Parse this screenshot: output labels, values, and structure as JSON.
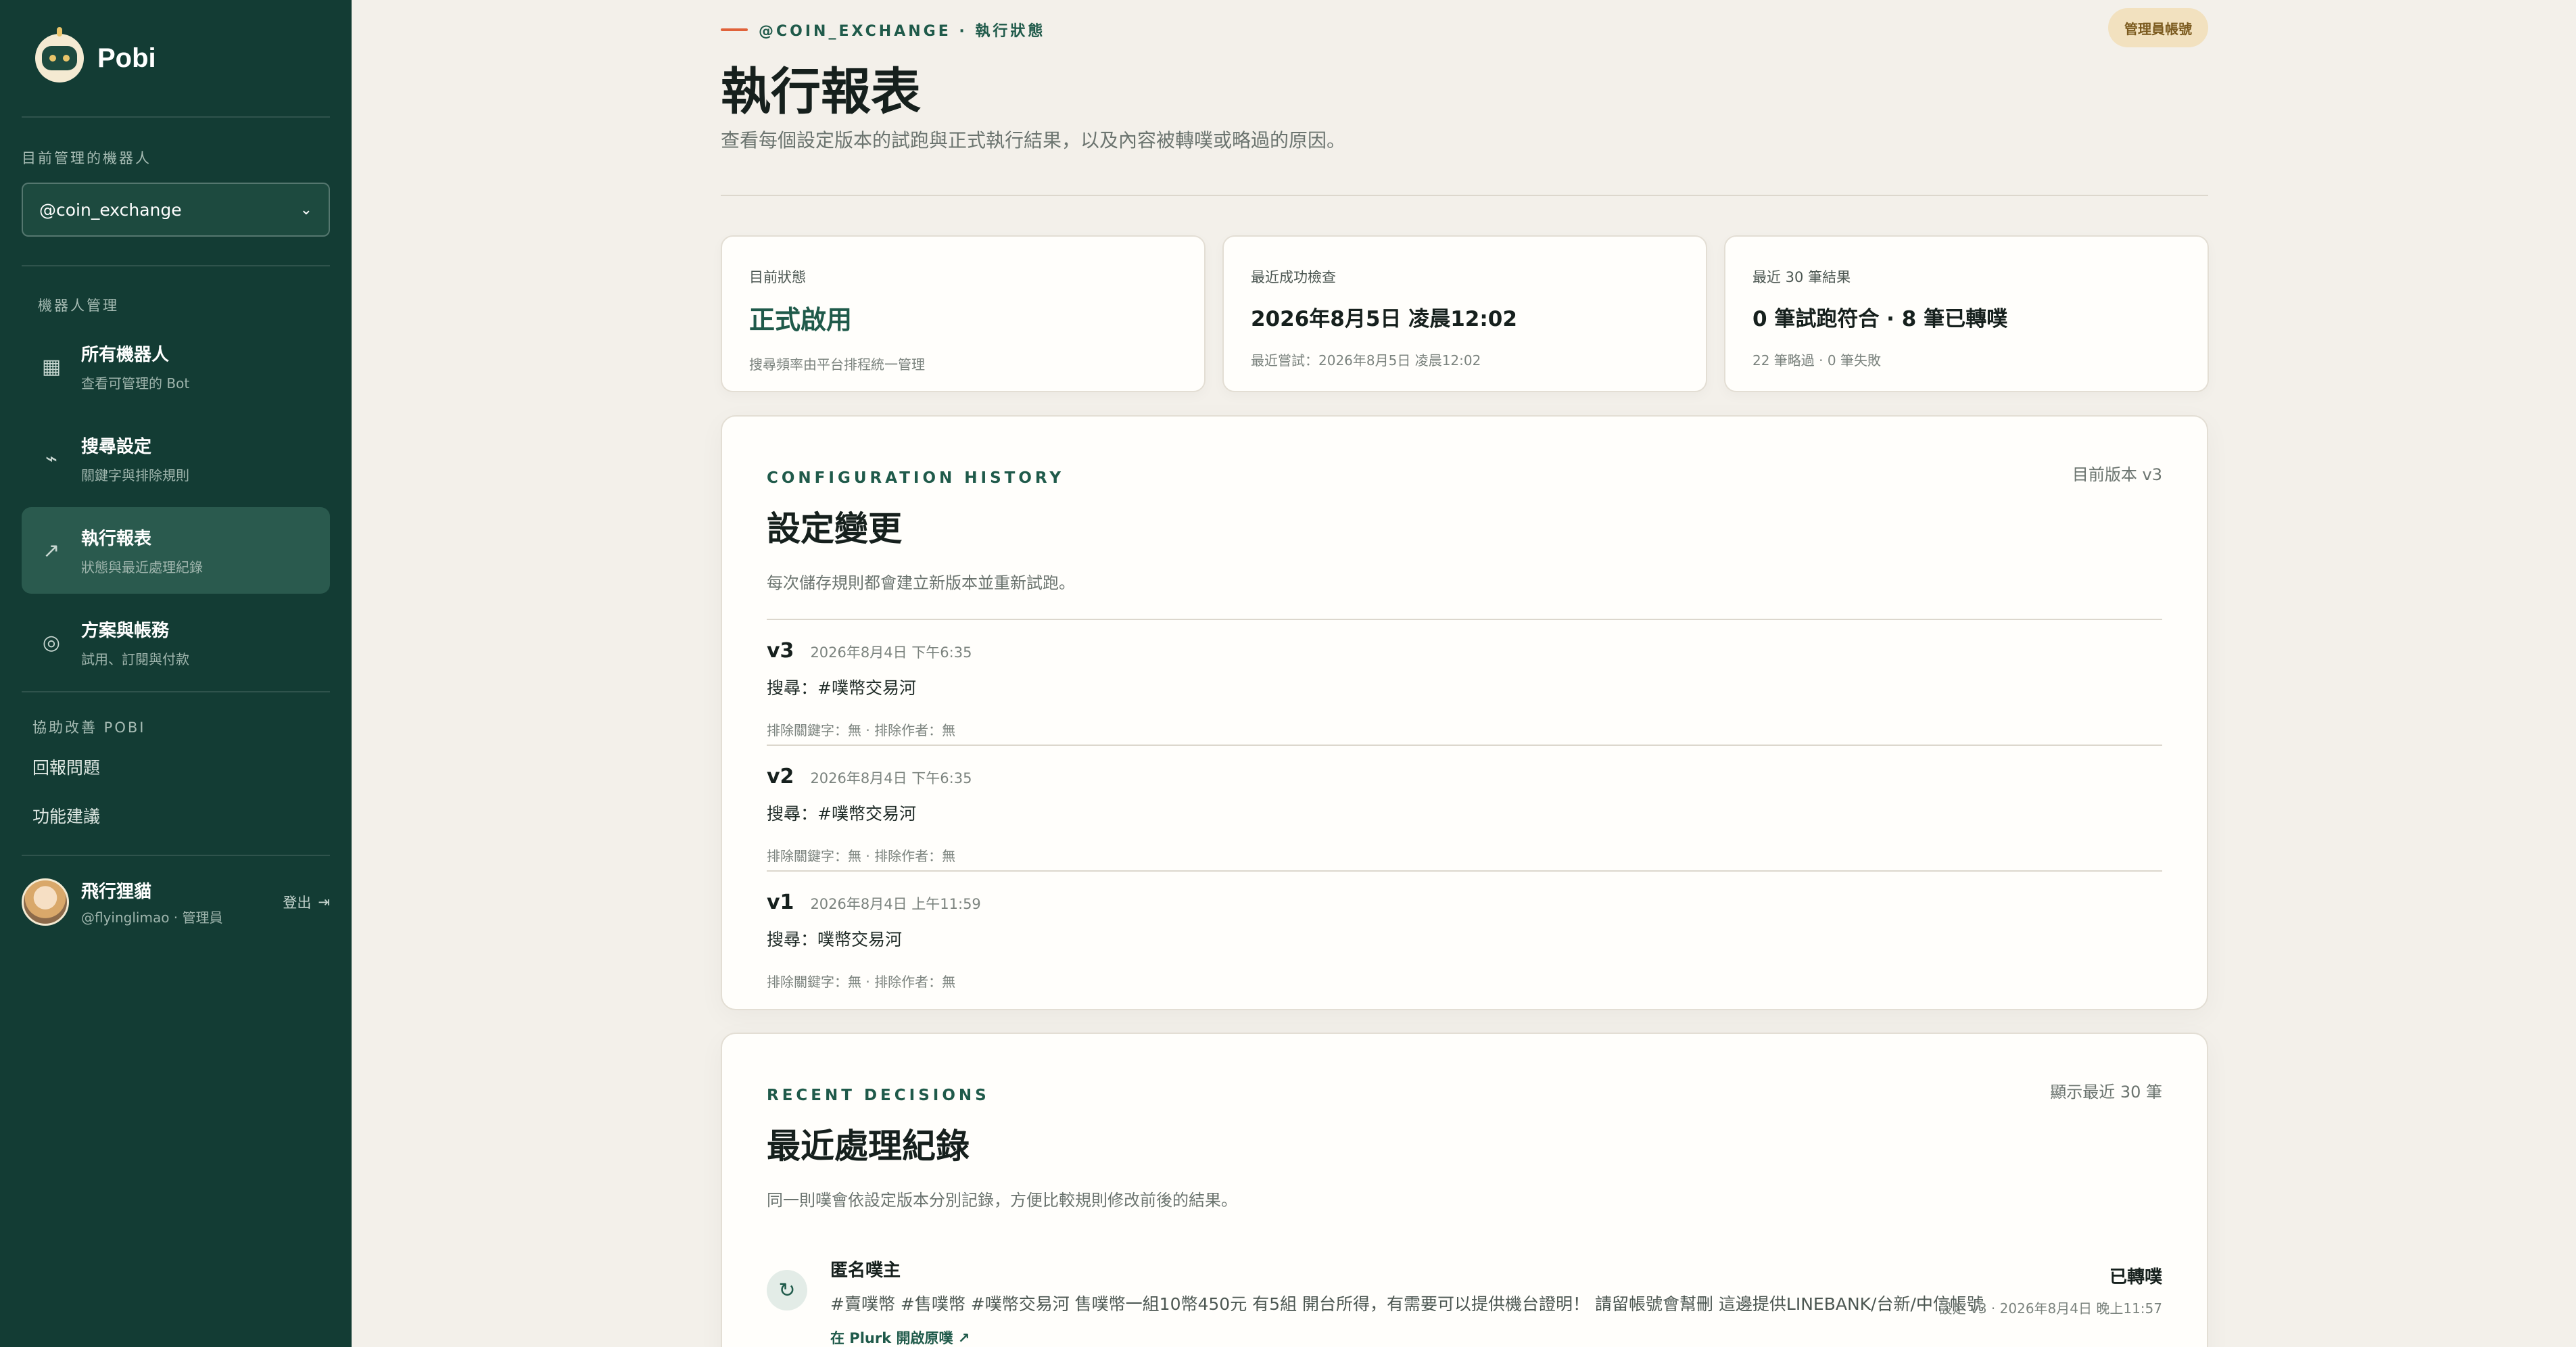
{
  "brand": {
    "name": "Pobi"
  },
  "sidebar": {
    "current_bot_label": "目前管理的機器人",
    "current_bot_value": "@coin_exchange",
    "section_label": "機器人管理",
    "items": [
      {
        "icon": "grid-icon",
        "title": "所有機器人",
        "sub": "查看可管理的 Bot"
      },
      {
        "icon": "wave-icon",
        "title": "搜尋設定",
        "sub": "關鍵字與排除規則"
      },
      {
        "icon": "trend-arrow-icon",
        "title": "執行報表",
        "sub": "狀態與最近處理紀錄"
      },
      {
        "icon": "target-icon",
        "title": "方案與帳務",
        "sub": "試用、訂閱與付款"
      }
    ],
    "help_label": "協助改善 POBI",
    "help_links": [
      "回報問題",
      "功能建議"
    ],
    "user": {
      "name": "飛行狸貓",
      "sub": "@flyinglimao · 管理員",
      "logout": "登出"
    }
  },
  "header": {
    "eyebrow": "@COIN_EXCHANGE · 執行狀態",
    "admin_badge": "管理員帳號",
    "title": "執行報表",
    "description": "查看每個設定版本的試跑與正式執行結果，以及內容被轉噗或略過的原因。"
  },
  "stats": [
    {
      "label": "目前狀態",
      "value": "正式啟用",
      "sub": "搜尋頻率由平台排程統一管理"
    },
    {
      "label": "最近成功檢查",
      "value": "2026年8月5日 凌晨12:02",
      "sub": "最近嘗試：2026年8月5日 凌晨12:02"
    },
    {
      "label": "最近 30 筆結果",
      "value": "0 筆試跑符合 · 8 筆已轉噗",
      "sub": "22 筆略過 · 0 筆失敗"
    }
  ],
  "config_history": {
    "eyebrow": "CONFIGURATION HISTORY",
    "title": "設定變更",
    "description": "每次儲存規則都會建立新版本並重新試跑。",
    "current_version": "目前版本 v3",
    "versions": [
      {
        "name": "v3",
        "date": "2026年8月4日 下午6:35",
        "query": "搜尋：#噗幣交易河",
        "exclusions": "排除關鍵字：無 · 排除作者：無"
      },
      {
        "name": "v2",
        "date": "2026年8月4日 下午6:35",
        "query": "搜尋：#噗幣交易河",
        "exclusions": "排除關鍵字：無 · 排除作者：無"
      },
      {
        "name": "v1",
        "date": "2026年8月4日 上午11:59",
        "query": "搜尋：噗幣交易河",
        "exclusions": "排除關鍵字：無 · 排除作者：無"
      }
    ]
  },
  "recent_decisions": {
    "eyebrow": "RECENT DECISIONS",
    "title": "最近處理紀錄",
    "description": "同一則噗會依設定版本分別記錄，方便比較規則修改前後的結果。",
    "meta": "顯示最近 30 筆",
    "items": [
      {
        "author": "匿名噗主",
        "text": "#賣噗幣 #售噗幣 #噗幣交易河 售噗幣一組10幣450元 有5組 開台所得，有需要可以提供機台證明！ 請留帳號會幫刪 這邊提供LINEBANK/台新/中信帳號",
        "link": "在 Plurk 開啟原噗 ↗",
        "status": "已轉噗",
        "date": "設定 v3 · 2026年8月4日 晚上11:57"
      }
    ]
  }
}
